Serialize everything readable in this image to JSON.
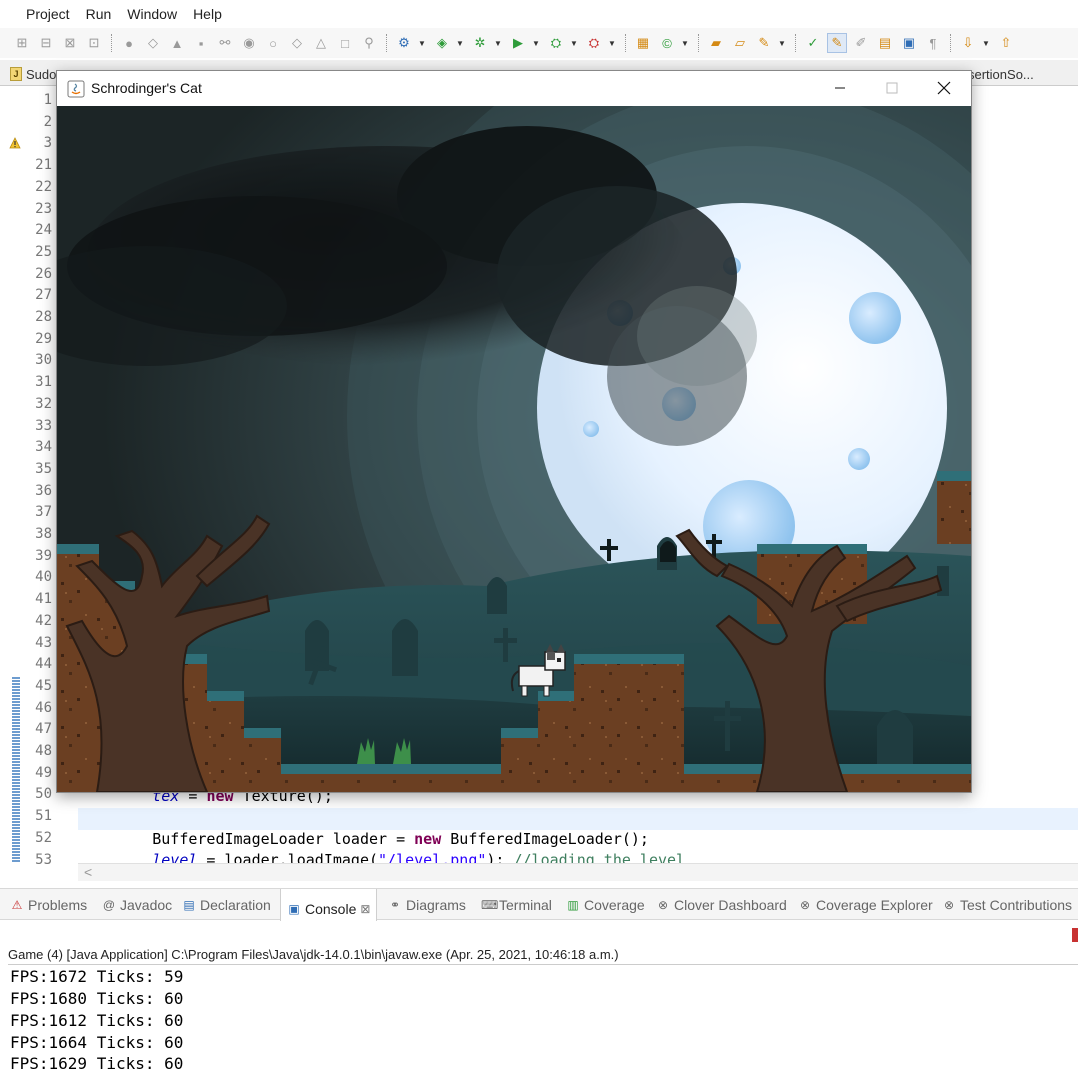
{
  "menubar": {
    "items": [
      "Project",
      "Run",
      "Window",
      "Help"
    ]
  },
  "editor_tabs": [
    {
      "label": "Sudo"
    },
    {
      "label": "sertionSo..."
    }
  ],
  "gutter": {
    "line_numbers": [
      "1",
      "2",
      "3",
      "21",
      "22",
      "23",
      "24",
      "25",
      "26",
      "27",
      "28",
      "29",
      "30",
      "31",
      "32",
      "33",
      "34",
      "35",
      "36",
      "37",
      "38",
      "39",
      "40",
      "41",
      "42",
      "43",
      "44",
      "45",
      "46",
      "47",
      "48",
      "49",
      "50",
      "51",
      "52",
      "53"
    ]
  },
  "code": {
    "line50": {
      "field": "tex",
      "eq": " = ",
      "kw": "new",
      "rest": " Texture();"
    },
    "line52": {
      "type": "BufferedImageLoader loader = ",
      "kw": "new",
      "rest": " BufferedImageLoader();"
    },
    "line53": {
      "field": "level",
      "rest": " = loader.loadImage(",
      "str": "\"/level.png\"",
      "end": "); ",
      "comment": "//loading the level"
    }
  },
  "game_window": {
    "title": "Schrodinger's Cat"
  },
  "panel_tabs": [
    {
      "label": "Problems",
      "icon": "problems-icon"
    },
    {
      "label": "Javadoc",
      "icon": "javadoc-icon"
    },
    {
      "label": "Declaration",
      "icon": "declaration-icon"
    },
    {
      "label": "Console",
      "icon": "console-icon",
      "close": "⊠"
    },
    {
      "label": "Diagrams",
      "icon": "diagrams-icon"
    },
    {
      "label": "Terminal",
      "icon": "terminal-icon"
    },
    {
      "label": "Coverage",
      "icon": "coverage-icon"
    },
    {
      "label": "Clover Dashboard",
      "icon": "clover-icon"
    },
    {
      "label": "Coverage Explorer",
      "icon": "coverage-explorer-icon"
    },
    {
      "label": "Test Contributions",
      "icon": "test-contributions-icon"
    }
  ],
  "console": {
    "description": "Game (4) [Java Application] C:\\Program Files\\Java\\jdk-14.0.1\\bin\\javaw.exe  (Apr. 25, 2021, 10:46:18 a.m.)",
    "lines": [
      "FPS:1672 Ticks: 59",
      "FPS:1680 Ticks: 60",
      "FPS:1612 Ticks: 60",
      "FPS:1664 Ticks: 60",
      "FPS:1629 Ticks: 60"
    ]
  },
  "colors": {
    "sky_dark": "#2a3a3a",
    "moon": "#e8f3ff",
    "ground_teal": "#2d6f78",
    "dirt": "#6b3f22",
    "tree": "#4a3326"
  }
}
